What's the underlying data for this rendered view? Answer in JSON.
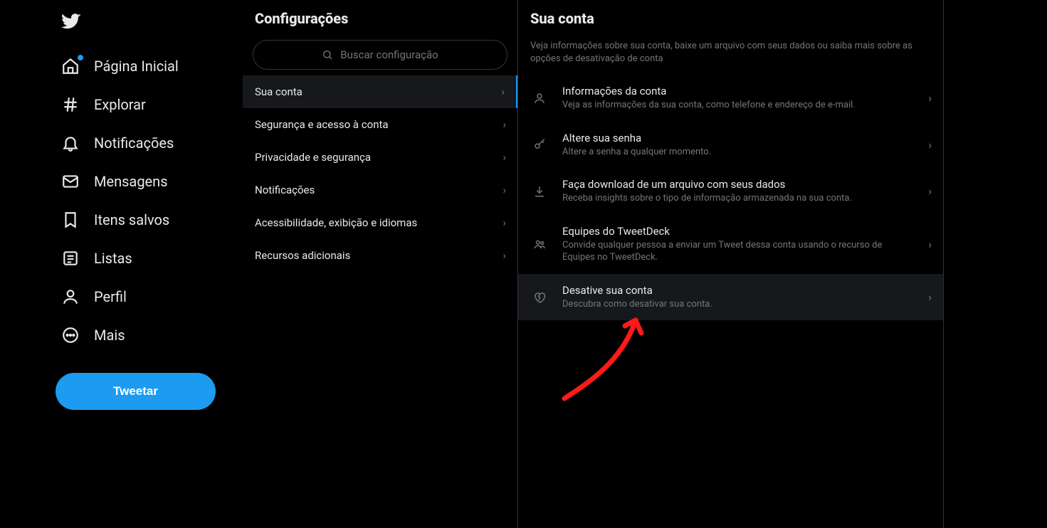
{
  "nav": {
    "items": [
      {
        "key": "home",
        "label": "Página Inicial",
        "dot": true
      },
      {
        "key": "explore",
        "label": "Explorar",
        "dot": false
      },
      {
        "key": "notifications",
        "label": "Notificações",
        "dot": false
      },
      {
        "key": "messages",
        "label": "Mensagens",
        "dot": false
      },
      {
        "key": "bookmarks",
        "label": "Itens salvos",
        "dot": false
      },
      {
        "key": "lists",
        "label": "Listas",
        "dot": false
      },
      {
        "key": "profile",
        "label": "Perfil",
        "dot": false
      },
      {
        "key": "more",
        "label": "Mais",
        "dot": false
      }
    ],
    "tweet_button": "Tweetar"
  },
  "settings_col": {
    "title": "Configurações",
    "search_placeholder": "Buscar configuração",
    "items": [
      {
        "label": "Sua conta",
        "active": true
      },
      {
        "label": "Segurança e acesso à conta",
        "active": false
      },
      {
        "label": "Privacidade e segurança",
        "active": false
      },
      {
        "label": "Notificações",
        "active": false
      },
      {
        "label": "Acessibilidade, exibição e idiomas",
        "active": false
      },
      {
        "label": "Recursos adicionais",
        "active": false
      }
    ]
  },
  "account_col": {
    "title": "Sua conta",
    "description": "Veja informações sobre sua conta, baixe um arquivo com seus dados ou saiba mais sobre as opções de desativação de conta",
    "items": [
      {
        "icon": "person",
        "title": "Informações da conta",
        "sub": "Veja as informações da sua conta, como telefone e endereço de e-mail."
      },
      {
        "icon": "key",
        "title": "Altere sua senha",
        "sub": "Altere a senha a qualquer momento."
      },
      {
        "icon": "download",
        "title": "Faça download de um arquivo com seus dados",
        "sub": "Receba insights sobre o tipo de informação armazenada na sua conta."
      },
      {
        "icon": "team",
        "title": "Equipes do TweetDeck",
        "sub": "Convide qualquer pessoa a enviar um Tweet dessa conta usando o recurso de Equipes no TweetDeck."
      },
      {
        "icon": "heart-broken",
        "title": "Desative sua conta",
        "sub": "Descubra como desativar sua conta."
      }
    ],
    "hovered_index": 4
  },
  "colors": {
    "accent": "#1d9bf0",
    "bg": "#000000",
    "muted": "#71767b"
  },
  "annotation": {
    "type": "arrow",
    "color": "#ff0000",
    "target": "deactivate-account-item"
  }
}
